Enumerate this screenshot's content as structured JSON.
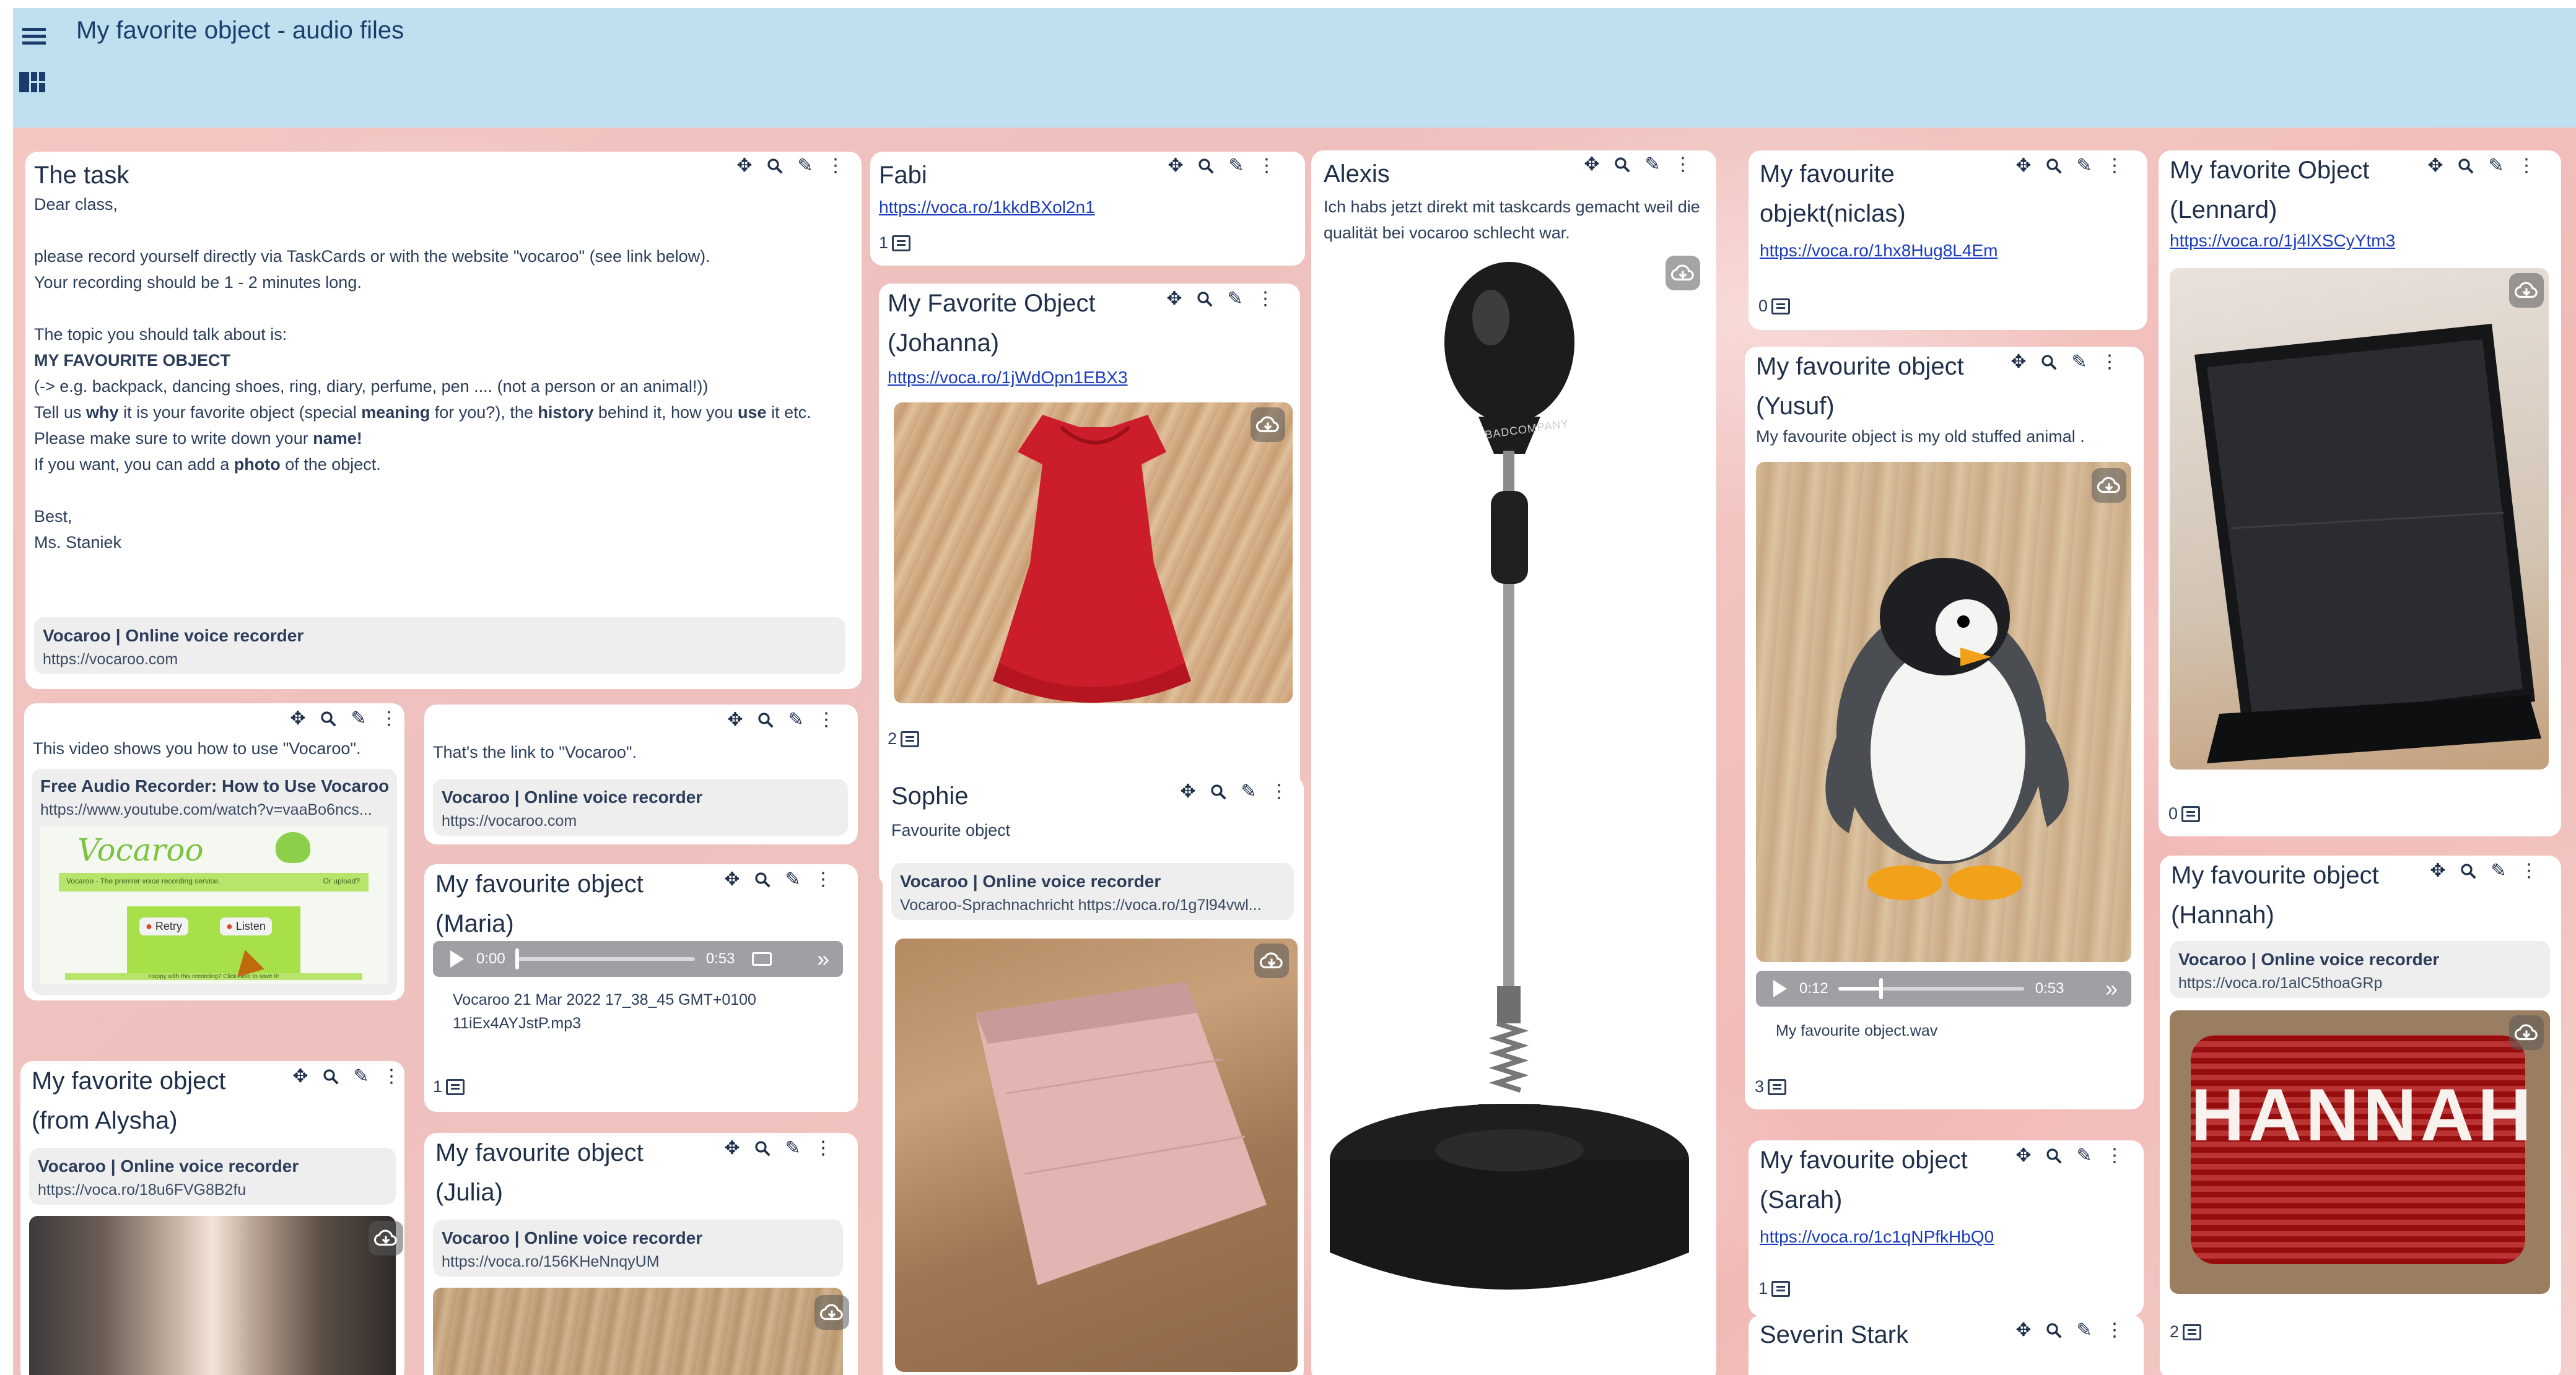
{
  "header": {
    "title": "My favorite object - audio files"
  },
  "icons": {
    "move": "move-icon",
    "zoom": "search-icon",
    "edit": "pencil-icon",
    "more": "more-vertical-icon",
    "comment": "comment-icon",
    "download": "cloud-download-icon",
    "menu": "hamburger-menu-icon",
    "layout": "layout-grid-icon"
  },
  "cards": {
    "task": {
      "title": "The task",
      "greeting": "Dear class,",
      "p1a": "please record yourself directly via TaskCards or with the website \"vocaroo\" (see link below).",
      "p1b": "Your recording should be 1 - 2 minutes long.",
      "topic_intro": "The topic you should talk about is:",
      "topic": "MY FAVOURITE OBJECT",
      "example": "(-> e.g.  backpack, dancing shoes, ring, diary, perfume, pen .... (not a person or an animal!))",
      "tell_1": "Tell us ",
      "tell_why": "why",
      "tell_2": " it is your favorite object (special ",
      "tell_meaning": "meaning",
      "tell_3": " for you?), the ",
      "tell_history": "history",
      "tell_4": " behind it, how you ",
      "tell_use": "use",
      "tell_5": " it etc.",
      "name_1": "Please make sure to write down your ",
      "name_bold": "name!",
      "photo_1": "If you want, you can add a ",
      "photo_bold": "photo",
      "photo_2": " of the object.",
      "sign1": "Best,",
      "sign2": "Ms. Staniek",
      "link_title": "Vocaroo | Online voice recorder",
      "link_url": "https://vocaroo.com"
    },
    "video": {
      "text": "This video shows you how to use \"Vocaroo\".",
      "link_title": "Free Audio Recorder: How to Use Vocaroo",
      "link_url": "https://www.youtube.com/watch?v=vaaBo6ncs...",
      "thumb_logo": "Vocaroo",
      "thumb_tagline": "Vocaroo - The premier voice recording service.",
      "thumb_upload": "Or upload?",
      "thumb_retry": "Retry",
      "thumb_listen": "Listen",
      "thumb_footer": "Happy with this recording? Click here to save it!"
    },
    "vlink": {
      "text": "That's the link to \"Vocaroo\".",
      "link_title": "Vocaroo | Online voice recorder",
      "link_url": "https://vocaroo.com"
    },
    "alysha": {
      "title": "My favorite object (from Alysha)",
      "link_title": "Vocaroo | Online voice recorder",
      "link_url": "https://voca.ro/18u6FVG8B2fu"
    },
    "maria": {
      "title": "My favourite object (Maria)",
      "time_now": "0:00",
      "time_total": "0:53",
      "file1": "Vocaroo 21 Mar 2022 17_38_45 GMT+0100",
      "file2": "11iEx4AYJstP.mp3",
      "comments": "1"
    },
    "julia": {
      "title": "My favourite object (Julia)",
      "link_title": "Vocaroo | Online voice recorder",
      "link_url": "https://voca.ro/156KHeNnqyUM"
    },
    "fabi": {
      "title": "Fabi",
      "link": "https://voca.ro/1kkdBXol2n1",
      "comments": "1"
    },
    "johanna": {
      "title": "My Favorite Object (Johanna)",
      "link": "https://voca.ro/1jWdOpn1EBX3",
      "comments": "2"
    },
    "sophie": {
      "title": "Sophie",
      "text": "Favourite object",
      "link_title": "Vocaroo | Online voice recorder",
      "link_url": "Vocaroo-Sprachnachricht https://voca.ro/1g7l94vwl..."
    },
    "alexis": {
      "title": "Alexis",
      "text": "Ich habs jetzt direkt mit taskcards gemacht weil die qualität bei vocaroo schlecht war.",
      "brand": "BADCOMPANY"
    },
    "niclas": {
      "title": "My favourite objekt(niclas)",
      "link": "https://voca.ro/1hx8Hug8L4Em",
      "comments": "0"
    },
    "yusuf": {
      "title": "My favourite object (Yusuf)",
      "text": "My favourite object is my  old stuffed animal .",
      "time_now": "0:12",
      "time_total": "0:53",
      "file": "My favourite object.wav",
      "comments": "3"
    },
    "sarah": {
      "title": "My favourite object (Sarah)",
      "link": "https://voca.ro/1c1qNPfkHbQ0",
      "comments": "1"
    },
    "severin": {
      "title": "Severin Stark"
    },
    "lennard": {
      "title": "My favorite Object (Lennard)",
      "link": "https://voca.ro/1j4lXSCyYtm3",
      "comments": "0"
    },
    "hannah": {
      "title": "My favourite object (Hannah)",
      "link_title": "Vocaroo | Online voice recorder",
      "link_url": "https://voca.ro/1alC5thoaGRp",
      "pillow_text": "HANNAH",
      "comments": "2"
    }
  },
  "colors": {
    "header_bg": "#bfe0ee",
    "title_color": "#1d3c6e",
    "board_bg": "#f2c4c0",
    "link_color": "#1a3bbd"
  }
}
